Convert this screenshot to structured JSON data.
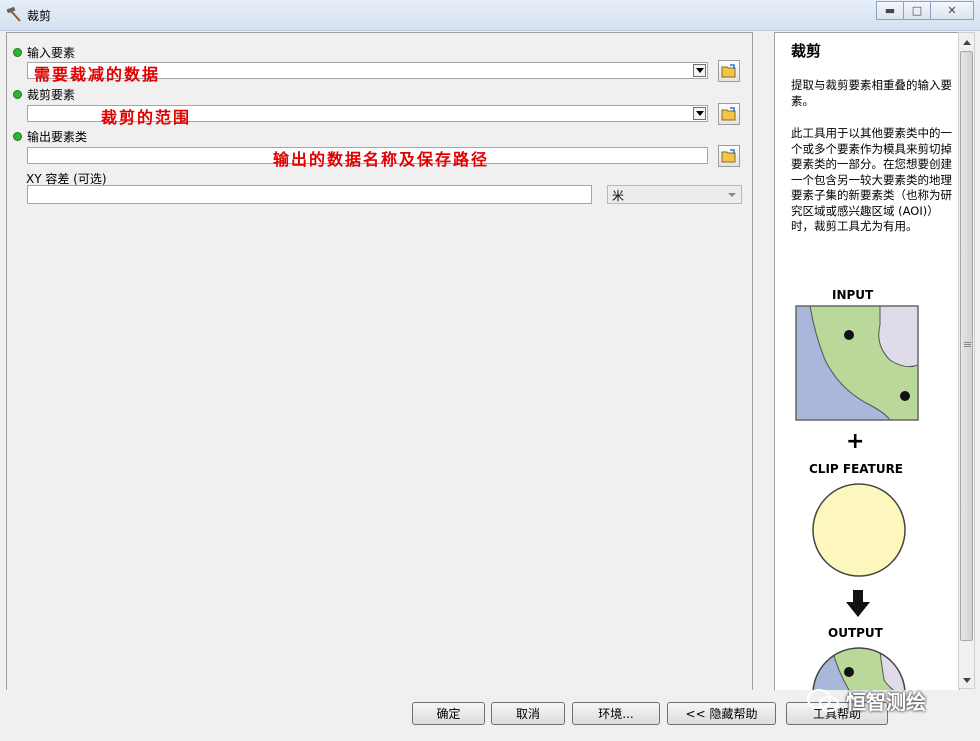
{
  "window": {
    "title": "裁剪",
    "controls": [
      "minimize",
      "maximize",
      "close"
    ]
  },
  "form": {
    "input_features": {
      "label": "输入要素",
      "annotation": "需要裁减的数据"
    },
    "clip_features": {
      "label": "裁剪要素",
      "annotation": "裁剪的范围"
    },
    "output_feature_class": {
      "label": "输出要素类",
      "annotation": "输出的数据名称及保存路径"
    },
    "xy_tolerance": {
      "label": "XY 容差 (可选)",
      "value": "",
      "unit": "米"
    }
  },
  "help": {
    "title": "裁剪",
    "summary": "提取与裁剪要素相重叠的输入要素。",
    "description": "此工具用于以其他要素类中的一个或多个要素作为模具来剪切掉要素类的一部分。在您想要创建一个包含另一较大要素类的地理要素子集的新要素类（也称为研究区域或感兴趣区域 (AOI)）时，裁剪工具尤为有用。",
    "figure": {
      "input_label": "INPUT",
      "plus": "+",
      "clip_label": "CLIP FEATURE",
      "output_label": "OUTPUT"
    }
  },
  "buttons": {
    "ok": "确定",
    "cancel": "取消",
    "environments": "环境...",
    "hide_help": "<< 隐藏帮助",
    "tool_help": "工具帮助"
  },
  "watermark": "恒智测绘"
}
